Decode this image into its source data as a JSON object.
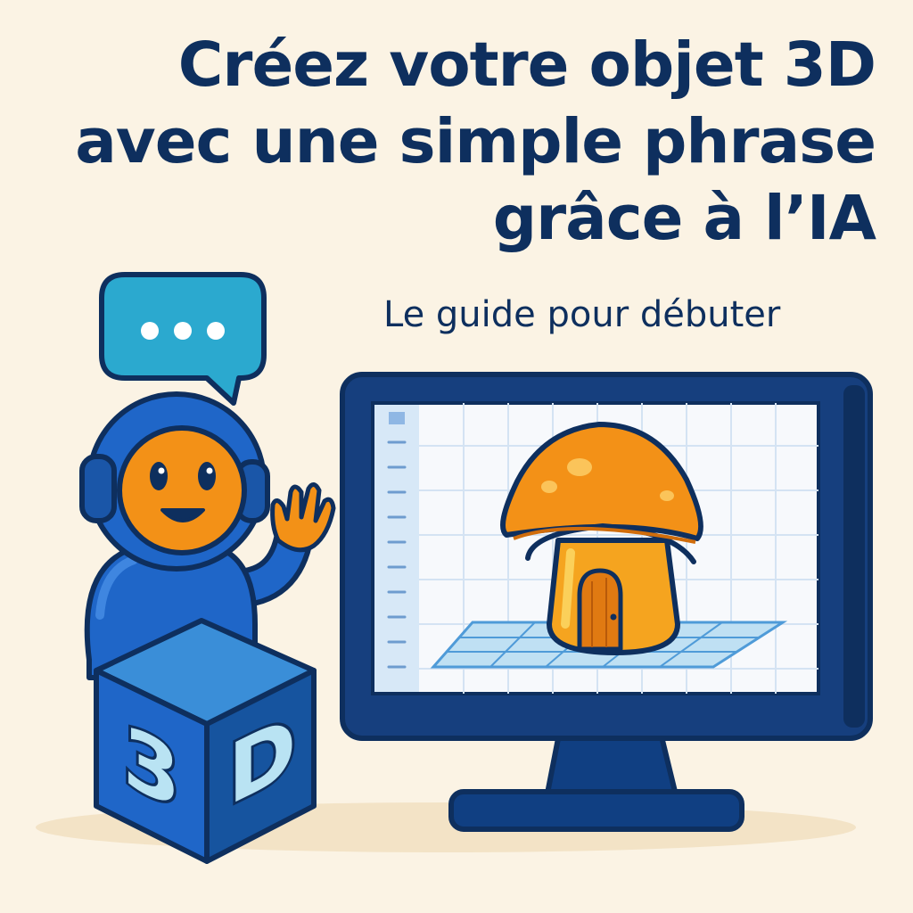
{
  "headline": {
    "line1": "Créez votre objet 3D",
    "line2": "avec une  simple phrase",
    "line3": "grâce  à l’IA"
  },
  "subtitle": "Le guide pour débuter",
  "cube": {
    "left_face": "3",
    "right_face": "D"
  },
  "colors": {
    "background": "#fbf3e4",
    "navy": "#0e2f5e",
    "robot_blue": "#1f66c8",
    "robot_orange": "#f39117",
    "speech_bubble": "#2ba9cf",
    "mushroom_orange": "#f39117",
    "screen_bg": "#f7f9fc"
  }
}
